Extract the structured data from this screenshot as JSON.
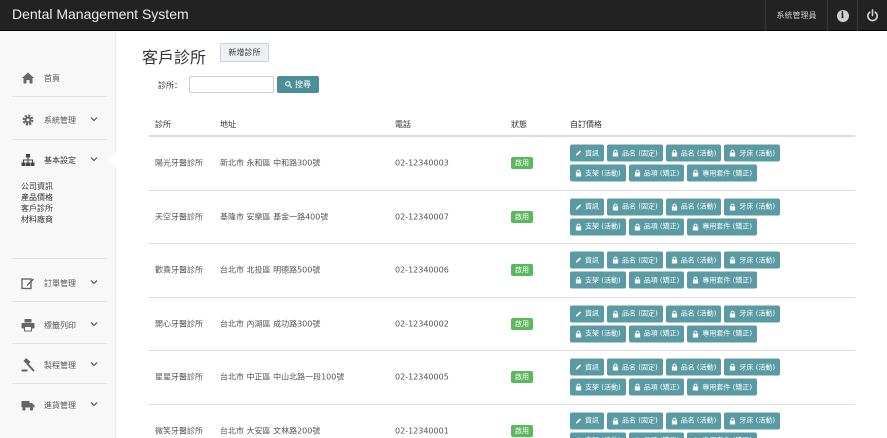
{
  "app": {
    "title": "Dental Management System",
    "user": "系統管理員"
  },
  "sidebar": {
    "items": [
      {
        "label": "首頁",
        "icon": "home-icon"
      },
      {
        "label": "系統管理",
        "icon": "gear-icon"
      },
      {
        "label": "基本設定",
        "icon": "sitemap-icon"
      },
      {
        "label": "訂單管理",
        "icon": "edit-icon"
      },
      {
        "label": "標籤列印",
        "icon": "print-icon"
      },
      {
        "label": "製程管理",
        "icon": "gavel-icon"
      },
      {
        "label": "進貨管理",
        "icon": "truck-icon"
      }
    ],
    "subitems": [
      "公司資訊",
      "產品價格",
      "客戶診所",
      "材料廠商"
    ]
  },
  "page": {
    "title": "客戶診所",
    "add_button": "新增診所",
    "search_label": "診所：",
    "search_value": "",
    "search_button": "搜尋"
  },
  "table": {
    "headers": [
      "診所",
      "地址",
      "電話",
      "狀態",
      "自訂價格"
    ],
    "rows": [
      {
        "name": "陽光牙醫診所",
        "address": "新北市 永和區 中和路300號",
        "phone": "02-12340003",
        "status": "啟用"
      },
      {
        "name": "天空牙醫診所",
        "address": "基隆市 安樂區 基金一路400號",
        "phone": "02-12340007",
        "status": "啟用"
      },
      {
        "name": "歡喜牙醫診所",
        "address": "台北市 北投區 明德路500號",
        "phone": "02-12340006",
        "status": "啟用"
      },
      {
        "name": "開心牙醫診所",
        "address": "台北市 內湖區 成功路300號",
        "phone": "02-12340002",
        "status": "啟用"
      },
      {
        "name": "星星牙醫診所",
        "address": "台北市 中正區 中山北路一段100號",
        "phone": "02-12340005",
        "status": "啟用"
      },
      {
        "name": "微笑牙醫診所",
        "address": "台北市 大安區 文林路200號",
        "phone": "02-12340001",
        "status": "啟用"
      }
    ],
    "action_buttons": [
      {
        "label": "資訊",
        "icon": "pencil-icon"
      },
      {
        "label": "品名 (固定)",
        "icon": "lock-icon"
      },
      {
        "label": "品名 (活動)",
        "icon": "lock-icon"
      },
      {
        "label": "牙床 (活動)",
        "icon": "lock-icon"
      },
      {
        "label": "支架 (活動)",
        "icon": "lock-icon"
      },
      {
        "label": "品項 (矯正)",
        "icon": "lock-icon"
      },
      {
        "label": "專用套件 (矯正)",
        "icon": "lock-icon"
      }
    ]
  },
  "colors": {
    "topbar": "#222222",
    "accent": "#5a9aa3",
    "status": "#5cb85c"
  }
}
